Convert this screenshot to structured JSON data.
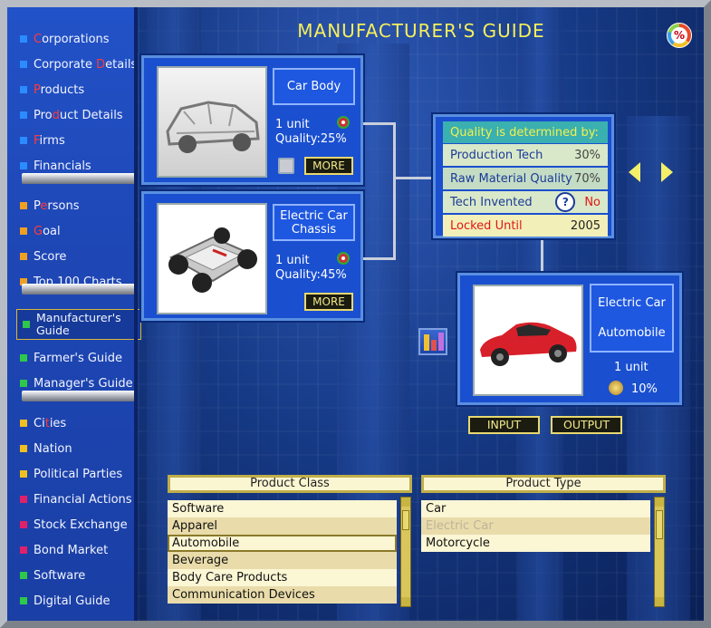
{
  "title": "MANUFACTURER'S GUIDE",
  "percent_icon": "%",
  "sidebar": {
    "items": [
      {
        "pre": "",
        "red": "C",
        "post": "orporations",
        "color": "#2b8cff"
      },
      {
        "pre": "Corporate ",
        "red": "D",
        "post": "etails",
        "color": "#2b8cff"
      },
      {
        "pre": "",
        "red": "P",
        "post": "roducts",
        "color": "#2b8cff"
      },
      {
        "pre": "Pro",
        "red": "d",
        "post": "uct Details",
        "color": "#2b8cff"
      },
      {
        "pre": "",
        "red": "F",
        "post": "irms",
        "color": "#2b8cff"
      },
      {
        "pre": "Financials",
        "red": "",
        "post": "",
        "color": "#2b8cff"
      },
      {
        "pre": "P",
        "red": "e",
        "post": "rsons",
        "color": "#f0a020"
      },
      {
        "pre": "",
        "red": "G",
        "post": "oal",
        "color": "#f0a020"
      },
      {
        "pre": "Score",
        "red": "",
        "post": "",
        "color": "#f0a020"
      },
      {
        "pre": "Top 100 Charts",
        "red": "",
        "post": "",
        "color": "#f0a020"
      },
      {
        "pre": "Manufacturer's Guide",
        "red": "",
        "post": "",
        "color": "#2ec84a"
      },
      {
        "pre": "Farmer's Guide",
        "red": "",
        "post": "",
        "color": "#2ec84a"
      },
      {
        "pre": "Manager's Guide",
        "red": "",
        "post": "",
        "color": "#2ec84a"
      },
      {
        "pre": "Ci",
        "red": "t",
        "post": "ies",
        "color": "#f0c020"
      },
      {
        "pre": "Nation",
        "red": "",
        "post": "",
        "color": "#f0c020"
      },
      {
        "pre": "Political Parties",
        "red": "",
        "post": "",
        "color": "#f0c020"
      },
      {
        "pre": "Financial Actions",
        "red": "",
        "post": "",
        "color": "#e0206a"
      },
      {
        "pre": "Stock Exchange",
        "red": "",
        "post": "",
        "color": "#e0206a"
      },
      {
        "pre": "Bond Market",
        "red": "",
        "post": "",
        "color": "#e0206a"
      },
      {
        "pre": "Software",
        "red": "",
        "post": "",
        "color": "#2ec84a"
      },
      {
        "pre": "Digital Guide",
        "red": "",
        "post": "",
        "color": "#2ec84a"
      }
    ]
  },
  "inputs": [
    {
      "name": "Car Body",
      "units": "1 unit",
      "quality": "Quality:25%",
      "more": "MORE"
    },
    {
      "name": "Electric Car Chassis",
      "units": "1 unit",
      "quality": "Quality:45%",
      "more": "MORE"
    }
  ],
  "quality_box": {
    "header": "Quality is determined by:",
    "rows": [
      {
        "label": "Production Tech",
        "value": "30%"
      },
      {
        "label": "Raw Material Quality",
        "value": "70%"
      },
      {
        "label": "Tech Invented",
        "value": "No",
        "icon": "?"
      },
      {
        "label": "Locked Until",
        "value": "2005"
      }
    ]
  },
  "output": {
    "line1": "Electric Car",
    "line2": "Automobile",
    "units": "1 unit",
    "percent": "10%"
  },
  "tabs": {
    "input": "INPUT",
    "output": "OUTPUT"
  },
  "product_class": {
    "header": "Product Class",
    "items": [
      "Software",
      "Apparel",
      "Automobile",
      "Beverage",
      "Body Care Products",
      "Communication Devices"
    ],
    "selected": "Automobile"
  },
  "product_type": {
    "header": "Product Type",
    "items": [
      "Car",
      "Electric Car",
      "Motorcycle"
    ],
    "disabled": "Electric Car"
  },
  "colors": {
    "title": "#f6ef5a",
    "panel": "#1a4fd0",
    "list_highlight": "#e9dcaa"
  }
}
